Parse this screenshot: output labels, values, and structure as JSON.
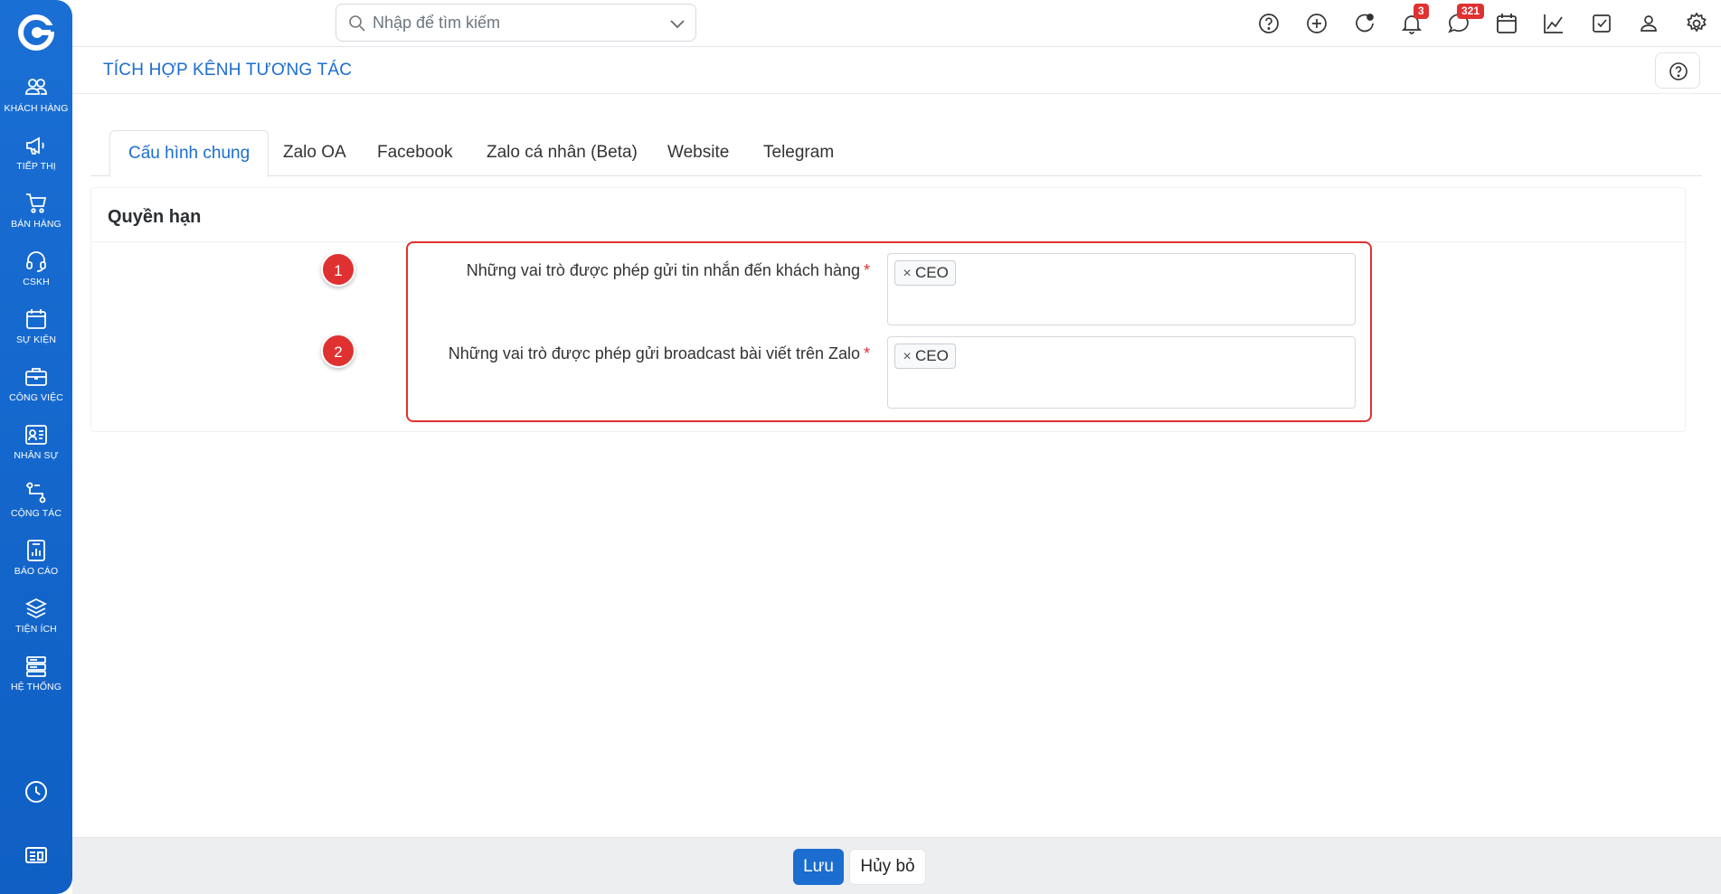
{
  "sidebar": {
    "items": [
      {
        "label": "KHÁCH HÀNG",
        "icon": "users-icon"
      },
      {
        "label": "TIẾP THỊ",
        "icon": "megaphone-icon"
      },
      {
        "label": "BÁN HÀNG",
        "icon": "cart-icon"
      },
      {
        "label": "CSKH",
        "icon": "headset-icon"
      },
      {
        "label": "SỰ KIỆN",
        "icon": "calendar-icon"
      },
      {
        "label": "CÔNG VIỆC",
        "icon": "briefcase-icon"
      },
      {
        "label": "NHÂN SỰ",
        "icon": "id-card-icon"
      },
      {
        "label": "CỘNG TÁC",
        "icon": "flow-icon"
      },
      {
        "label": "BÁO CÁO",
        "icon": "report-icon"
      },
      {
        "label": "TIỆN ÍCH",
        "icon": "layers-icon"
      },
      {
        "label": "HỆ THỐNG",
        "icon": "server-icon"
      }
    ],
    "bottom": [
      {
        "icon": "clock-icon"
      },
      {
        "icon": "news-icon"
      }
    ]
  },
  "topbar": {
    "search_placeholder": "Nhập để tìm kiếm",
    "notification_count": "3",
    "message_count": "321"
  },
  "page": {
    "title": "TÍCH HỢP KÊNH TƯƠNG TÁC"
  },
  "tabs": [
    {
      "label": "Cấu hình chung",
      "active": true
    },
    {
      "label": "Zalo OA"
    },
    {
      "label": "Facebook"
    },
    {
      "label": "Zalo cá nhân (Beta)"
    },
    {
      "label": "Website"
    },
    {
      "label": "Telegram"
    }
  ],
  "section": {
    "title": "Quyền hạn",
    "fields": [
      {
        "marker": "1",
        "label": "Những vai trò được phép gửi tin nhắn đến khách hàng",
        "required": "*",
        "tags": [
          "CEO"
        ]
      },
      {
        "marker": "2",
        "label": "Những vai trò được phép gửi broadcast bài viết trên Zalo",
        "required": "*",
        "tags": [
          "CEO"
        ]
      }
    ]
  },
  "footer": {
    "save_label": "Lưu",
    "cancel_label": "Hủy bỏ"
  },
  "colors": {
    "primary": "#1c6dd0",
    "highlight": "#e03131"
  }
}
